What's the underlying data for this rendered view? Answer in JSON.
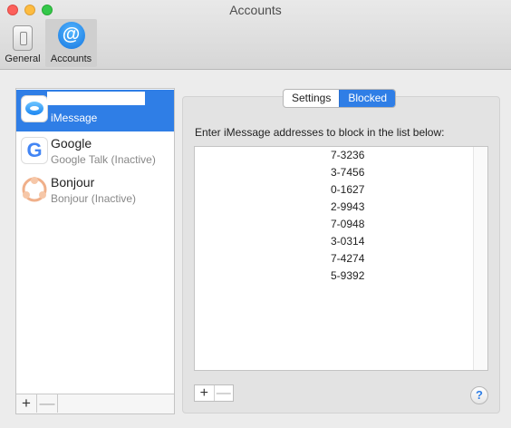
{
  "window": {
    "title": "Accounts"
  },
  "toolbar": {
    "items": [
      {
        "label": "General",
        "icon": "switch-icon"
      },
      {
        "label": "Accounts",
        "icon": "at-icon",
        "selected": true
      }
    ]
  },
  "accounts": {
    "items": [
      {
        "name": "",
        "status": "iMessage",
        "icon": "imessage-icon",
        "selected": true
      },
      {
        "name": "Google",
        "status": "Google Talk (Inactive)",
        "icon": "google-icon"
      },
      {
        "name": "Bonjour",
        "status": "Bonjour (Inactive)",
        "icon": "bonjour-icon"
      }
    ],
    "add_label": "+",
    "remove_label": "—"
  },
  "tabs": [
    {
      "label": "Settings",
      "active": false
    },
    {
      "label": "Blocked",
      "active": true
    }
  ],
  "blocked": {
    "instruction": "Enter iMessage addresses to block in the list below:",
    "entries": [
      "7-3236",
      "3-7456",
      "0-1627",
      "2-9943",
      "7-0948",
      "3-0314",
      "7-4274",
      "5-9392"
    ],
    "add_label": "+",
    "remove_label": "—"
  },
  "help_label": "?",
  "colors": {
    "accent": "#2f7ee6"
  }
}
